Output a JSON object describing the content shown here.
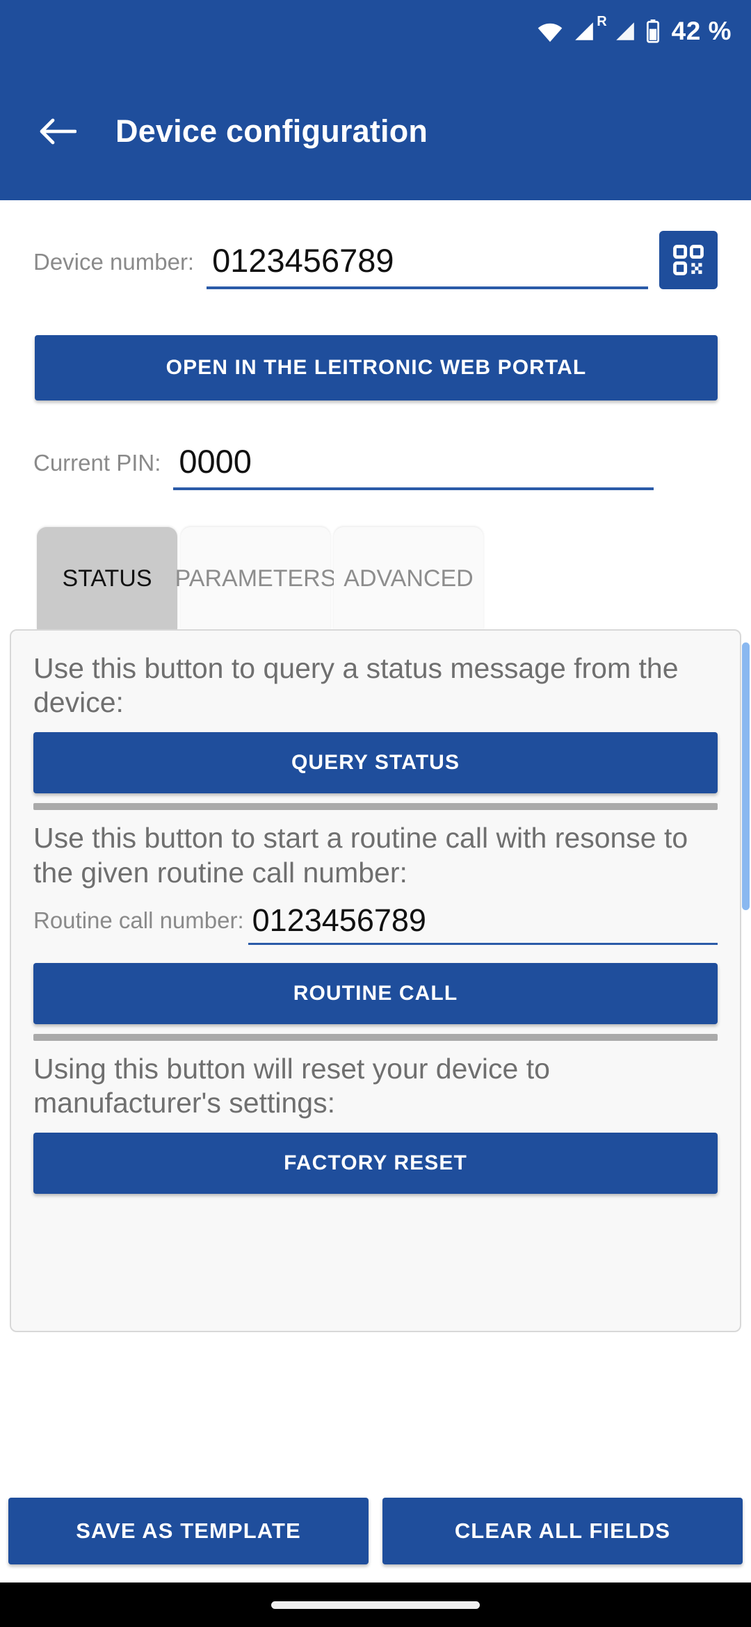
{
  "statusbar": {
    "icons": [
      "wifi-icon",
      "signal-roaming-icon",
      "signal-icon",
      "battery-icon"
    ],
    "battery_percent": "42 %",
    "roaming_label": "R"
  },
  "appbar": {
    "back_icon": "back-arrow-icon",
    "title": "Device configuration",
    "background_color": "#1F4E9C"
  },
  "device_number": {
    "label": "Device number:",
    "value": "0123456789",
    "placeholder": "Device number",
    "scan_icon": "qr-code-icon"
  },
  "portal_button": {
    "label": "OPEN IN THE LEITRONIC WEB PORTAL"
  },
  "current_pin": {
    "label": "Current PIN:",
    "value": "0000",
    "placeholder": "PIN"
  },
  "tabs": [
    {
      "label": "STATUS",
      "active": true
    },
    {
      "label": "PARAMETERS",
      "active": false
    },
    {
      "label": "ADVANCED",
      "active": false
    }
  ],
  "status_panel": {
    "query_help": "Use this button to query a status message from the device:",
    "query_button": "QUERY STATUS",
    "routine_help": "Use this button to start a routine call with resonse to the given routine call number:",
    "routine_number": {
      "label": "Routine call number:",
      "value": "0123456789",
      "placeholder": "Routine call number"
    },
    "routine_button": "ROUTINE CALL",
    "reset_help": "Using this button will reset your device to manufacturer's settings:",
    "reset_button": "FACTORY RESET"
  },
  "bottom_actions": {
    "save_label": "SAVE AS TEMPLATE",
    "clear_label": "CLEAR ALL FIELDS"
  },
  "colors": {
    "brand_blue": "#1F4E9C",
    "underline_blue": "#2B5BA8",
    "scrollbar_blue": "#8AB8F0",
    "tab_active_bg": "#CACACA",
    "card_bg": "#F8F8F8",
    "divider_gray": "#AAAAAA",
    "label_gray": "#8A8A8A"
  },
  "navbar": {
    "gesture_pill": "home-gesture-pill"
  }
}
